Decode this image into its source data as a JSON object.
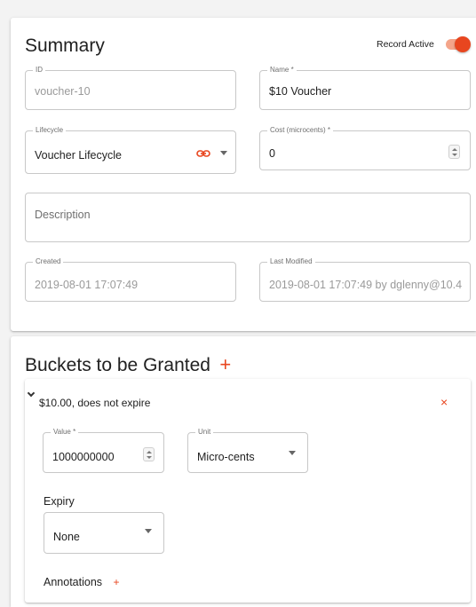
{
  "summary": {
    "title": "Summary",
    "record_active_label": "Record Active",
    "record_active": true,
    "id_field": {
      "label": "ID",
      "value": "voucher-10"
    },
    "name_field": {
      "label": "Name *",
      "value": "$10 Voucher"
    },
    "lifecycle_field": {
      "label": "Lifecycle",
      "value": "Voucher Lifecycle"
    },
    "cost_field": {
      "label": "Cost (microcents) *",
      "value": "0"
    },
    "description_field": {
      "placeholder": "Description"
    },
    "created_field": {
      "label": "Created",
      "value": "2019-08-01 17:07:49"
    },
    "last_modified_field": {
      "label": "Last Modified",
      "value": "2019-08-01 17:07:49 by dglenny@10.4"
    }
  },
  "buckets": {
    "title": "Buckets to be Granted",
    "add_symbol": "+",
    "panel": {
      "header": "$10.00, does not expire",
      "close_symbol": "×",
      "value_field": {
        "label": "Value *",
        "value": "1000000000"
      },
      "unit_field": {
        "label": "Unit",
        "value": "Micro-cents"
      },
      "expiry_label": "Expiry",
      "expiry_field": {
        "value": "None"
      },
      "annotations_label": "Annotations",
      "annotations_add_symbol": "+"
    }
  },
  "colors": {
    "accent": "#e8461f",
    "toggle_track": "#f4a58a",
    "border": "#c8c8c8",
    "disabled_text": "#9a9a9a"
  },
  "icons": {
    "lifecycle_link": "link-icon",
    "dropdown": "chevron-down-icon",
    "stepper": "number-stepper-icon",
    "expand": "chevron-down-icon",
    "close": "close-icon",
    "add": "plus-icon"
  }
}
